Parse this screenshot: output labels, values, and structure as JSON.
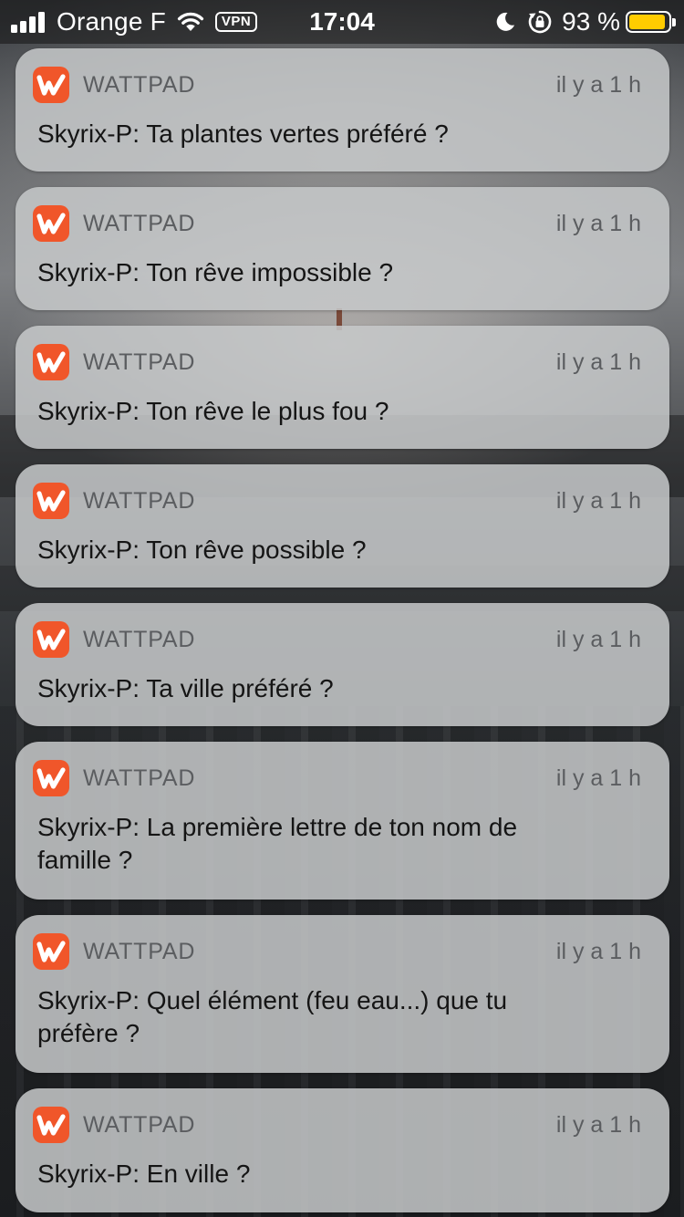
{
  "status_bar": {
    "carrier": "Orange F",
    "vpn_label": "VPN",
    "time": "17:04",
    "battery_text": "93 %",
    "battery_level": 0.93,
    "battery_color": "#ffcc00",
    "icons": [
      "signal-icon",
      "wifi-icon",
      "moon-icon",
      "rotation-lock-icon",
      "battery-icon"
    ]
  },
  "notifications": [
    {
      "app": "WATTPAD",
      "time": "il y a 1 h",
      "message": "Skyrix-P: Ta plantes vertes préféré ?"
    },
    {
      "app": "WATTPAD",
      "time": "il y a 1 h",
      "message": "Skyrix-P: Ton rêve impossible ?"
    },
    {
      "app": "WATTPAD",
      "time": "il y a 1 h",
      "message": "Skyrix-P: Ton rêve le plus fou ?"
    },
    {
      "app": "WATTPAD",
      "time": "il y a 1 h",
      "message": "Skyrix-P: Ton rêve possible ?"
    },
    {
      "app": "WATTPAD",
      "time": "il y a 1 h",
      "message": "Skyrix-P: Ta ville préféré ?"
    },
    {
      "app": "WATTPAD",
      "time": "il y a 1 h",
      "message": "Skyrix-P: La première lettre de ton nom de famille ?"
    },
    {
      "app": "WATTPAD",
      "time": "il y a 1 h",
      "message": "Skyrix-P: Quel élément (feu eau...) que tu préfère ?"
    },
    {
      "app": "WATTPAD",
      "time": "il y a 1 h",
      "message": "Skyrix-P: En ville ?"
    }
  ],
  "app_icon": {
    "name": "wattpad-icon",
    "color": "#f0562a"
  }
}
